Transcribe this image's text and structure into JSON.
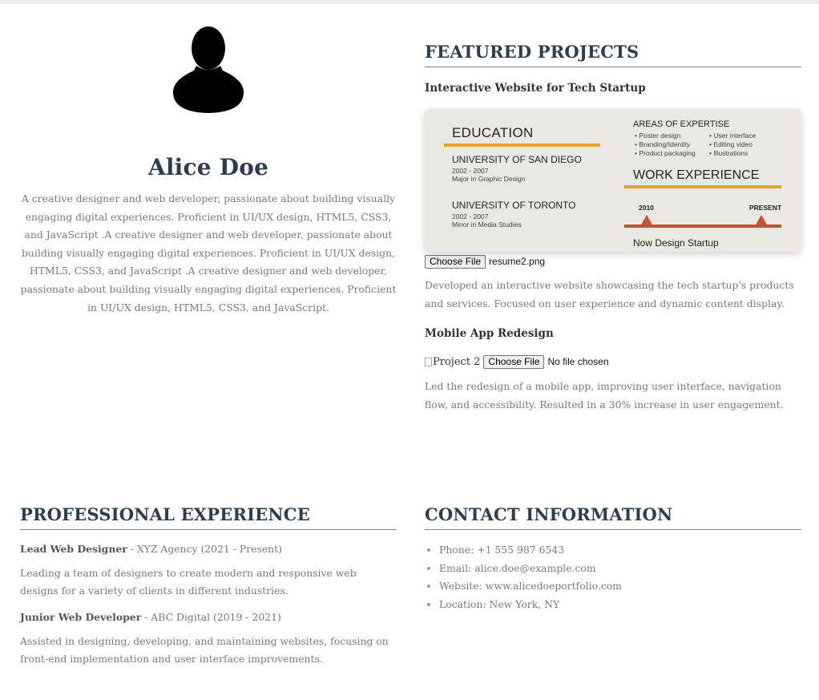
{
  "profile": {
    "name": "Alice Doe",
    "bio": "A creative designer and web developer, passionate about building visually engaging digital experiences. Proficient in UI/UX design, HTML5, CSS3, and JavaScript .A creative designer and web developer, passionate about building visually engaging digital experiences. Proficient in UI/UX design, HTML5, CSS3, and JavaScript .A creative designer and web developer, passionate about building visually engaging digital experiences. Proficient in UI/UX design, HTML5, CSS3, and JavaScript."
  },
  "projects": {
    "title": "FEATURED PROJECTS",
    "items": [
      {
        "title": "Interactive Website for Tech Startup",
        "file_button": "Choose File",
        "file_name": "resume2.png",
        "description": "Developed an interactive website showcasing the tech startup's products and services. Focused on user experience and dynamic content display.",
        "image": {
          "education_heading": "EDUCATION",
          "school1": "UNIVERSITY OF SAN DIEGO",
          "school1_years": "2002 - 2007",
          "school1_degree": "Major in Graphic Design",
          "school2": "UNIVERSITY OF TORONTO",
          "school2_years": "2002 - 2007",
          "school2_degree": "Minor in Media Studies",
          "expertise_heading": "AREAS OF EXPERTISE",
          "expertise_left": [
            "• Poster design",
            "• Branding/Identity",
            "• Product packaging"
          ],
          "expertise_right": [
            "• User interface",
            "• Editing video",
            "• Illustrations"
          ],
          "work_heading": "WORK EXPERIENCE",
          "timeline_start": "2010",
          "timeline_end": "PRESENT",
          "work_company": "Now Design Startup"
        }
      },
      {
        "title": "Mobile App Redesign",
        "image_alt": "Project 2",
        "file_button": "Choose File",
        "file_name": "No file chosen",
        "description": "Led the redesign of a mobile app, improving user interface, navigation flow, and accessibility. Resulted in a 30% increase in user engagement."
      }
    ]
  },
  "experience": {
    "title": "PROFESSIONAL EXPERIENCE",
    "jobs": [
      {
        "role": "Lead Web Designer",
        "meta": " - XYZ Agency (2021 - Present)",
        "description": "Leading a team of designers to create modern and responsive web designs for a variety of clients in different industries."
      },
      {
        "role": "Junior Web Developer",
        "meta": " - ABC Digital (2019 - 2021)",
        "description": "Assisted in designing, developing, and maintaining websites, focusing on front-end implementation and user interface improvements."
      }
    ]
  },
  "contact": {
    "title": "CONTACT INFORMATION",
    "items": [
      "Phone: +1 555 987 6543",
      "Email: alice.doe@example.com",
      "Website: www.alicedoeportfolio.com",
      "Location: New York, NY"
    ]
  },
  "colors": {
    "heading": "#2c3e50",
    "body_text": "#7a7a7a",
    "accent_orange": "#e0a52a",
    "accent_rust": "#c0552e"
  }
}
